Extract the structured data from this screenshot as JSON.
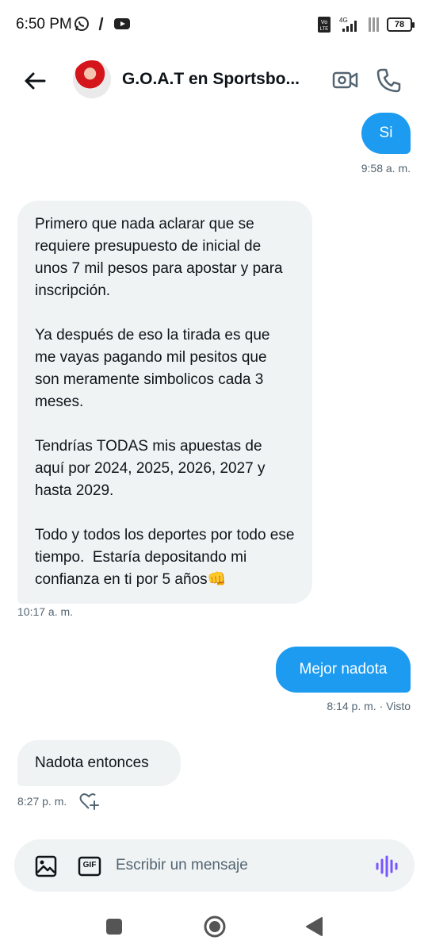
{
  "status": {
    "time": "6:50 PM",
    "battery": "78",
    "network": "4G",
    "volte": "Vo LTE"
  },
  "header": {
    "title": "G.O.A.T en Sportsbo..."
  },
  "messages": [
    {
      "direction": "out",
      "text": "Si",
      "meta": "9:58 a. m."
    },
    {
      "direction": "in",
      "text": "Primero que nada aclarar que se requiere presupuesto de inicial de unos 7 mil pesos para apostar y para inscripción.\n\nYa después de eso la tirada es que me vayas pagando mil pesitos que son meramente simbolicos cada 3 meses.\n\nTendrías TODAS mis apuestas de aquí por 2024, 2025, 2026, 2027 y hasta 2029.\n\nTodo y todos los deportes por todo ese tiempo.  Estaría depositando mi confianza en ti por 5 años👊",
      "meta": "10:17 a. m."
    },
    {
      "direction": "out",
      "text": "Mejor nadota",
      "meta": "8:14 p. m. · Visto"
    },
    {
      "direction": "in",
      "text": "Nadota entonces",
      "meta": "8:27 p. m."
    }
  ],
  "composer": {
    "placeholder": "Escribir un mensaje",
    "gif_label": "GIF"
  },
  "icons": {
    "back": "arrow-left-icon",
    "video": "video-camera-icon",
    "call": "phone-icon",
    "image": "image-icon",
    "gif": "gif-icon",
    "voice": "voice-wave-icon",
    "reaction": "heart-plus-icon"
  },
  "colors": {
    "outgoing_bubble": "#1d9bf0",
    "incoming_bubble": "#eff3f4",
    "voice_accent": "#7856ff",
    "meta_text": "#536471"
  }
}
